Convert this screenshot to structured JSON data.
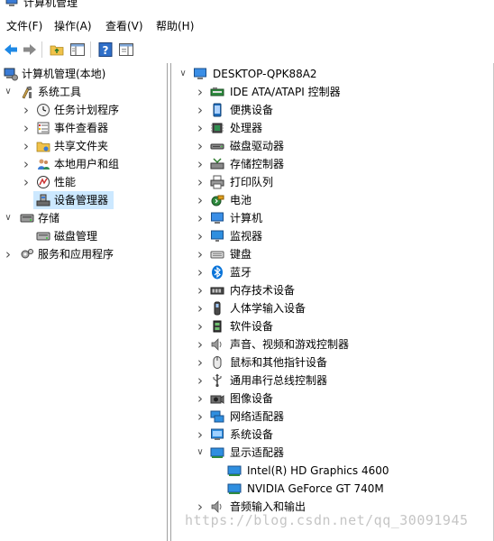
{
  "window": {
    "title": "计算机管理"
  },
  "menu": [
    "文件(F)",
    "操作(A)",
    "查看(V)",
    "帮助(H)"
  ],
  "toolbar": {
    "buttons": [
      "back-icon",
      "forward-icon",
      "up-folder-icon",
      "show-hide-tree-icon",
      "help-icon",
      "properties-icon"
    ]
  },
  "left_tree": [
    {
      "label": "计算机管理(本地)",
      "icon": "computer-management-icon",
      "level": 0,
      "expander": "none"
    },
    {
      "label": "系统工具",
      "icon": "system-tools-icon",
      "level": 1,
      "expander": "expanded"
    },
    {
      "label": "任务计划程序",
      "icon": "clock-icon",
      "level": 2,
      "expander": "collapsed"
    },
    {
      "label": "事件查看器",
      "icon": "event-viewer-icon",
      "level": 2,
      "expander": "collapsed"
    },
    {
      "label": "共享文件夹",
      "icon": "shared-folder-icon",
      "level": 2,
      "expander": "collapsed"
    },
    {
      "label": "本地用户和组",
      "icon": "users-icon",
      "level": 2,
      "expander": "collapsed"
    },
    {
      "label": "性能",
      "icon": "performance-icon",
      "level": 2,
      "expander": "collapsed"
    },
    {
      "label": "设备管理器",
      "icon": "device-manager-icon",
      "level": 2,
      "expander": "none",
      "selected": true
    },
    {
      "label": "存储",
      "icon": "storage-icon",
      "level": 1,
      "expander": "expanded"
    },
    {
      "label": "磁盘管理",
      "icon": "disk-management-icon",
      "level": 2,
      "expander": "none"
    },
    {
      "label": "服务和应用程序",
      "icon": "services-icon",
      "level": 1,
      "expander": "collapsed"
    }
  ],
  "device_tree": {
    "root": {
      "label": "DESKTOP-QPK88A2",
      "icon": "computer-icon"
    },
    "categories": [
      {
        "label": "IDE ATA/ATAPI 控制器",
        "icon": "ide-controller-icon",
        "expander": "collapsed"
      },
      {
        "label": "便携设备",
        "icon": "portable-device-icon",
        "expander": "collapsed"
      },
      {
        "label": "处理器",
        "icon": "processor-icon",
        "expander": "collapsed"
      },
      {
        "label": "磁盘驱动器",
        "icon": "disk-drive-icon",
        "expander": "collapsed"
      },
      {
        "label": "存储控制器",
        "icon": "storage-controller-icon",
        "expander": "collapsed"
      },
      {
        "label": "打印队列",
        "icon": "printer-icon",
        "expander": "collapsed"
      },
      {
        "label": "电池",
        "icon": "battery-icon",
        "expander": "collapsed"
      },
      {
        "label": "计算机",
        "icon": "computer-icon",
        "expander": "collapsed"
      },
      {
        "label": "监视器",
        "icon": "monitor-icon",
        "expander": "collapsed"
      },
      {
        "label": "键盘",
        "icon": "keyboard-icon",
        "expander": "collapsed"
      },
      {
        "label": "蓝牙",
        "icon": "bluetooth-icon",
        "expander": "collapsed"
      },
      {
        "label": "内存技术设备",
        "icon": "memory-device-icon",
        "expander": "collapsed"
      },
      {
        "label": "人体学输入设备",
        "icon": "hid-icon",
        "expander": "collapsed"
      },
      {
        "label": "软件设备",
        "icon": "software-device-icon",
        "expander": "collapsed"
      },
      {
        "label": "声音、视频和游戏控制器",
        "icon": "speaker-icon",
        "expander": "collapsed"
      },
      {
        "label": "鼠标和其他指针设备",
        "icon": "mouse-icon",
        "expander": "collapsed"
      },
      {
        "label": "通用串行总线控制器",
        "icon": "usb-icon",
        "expander": "collapsed"
      },
      {
        "label": "图像设备",
        "icon": "camera-icon",
        "expander": "collapsed"
      },
      {
        "label": "网络适配器",
        "icon": "network-adapter-icon",
        "expander": "collapsed"
      },
      {
        "label": "系统设备",
        "icon": "system-device-icon",
        "expander": "collapsed"
      },
      {
        "label": "显示适配器",
        "icon": "display-adapter-icon",
        "expander": "expanded",
        "children": [
          {
            "label": "Intel(R) HD Graphics 4600",
            "icon": "display-adapter-icon"
          },
          {
            "label": "NVIDIA GeForce GT 740M",
            "icon": "display-adapter-icon"
          }
        ]
      },
      {
        "label": "音频输入和输出",
        "icon": "speaker-icon",
        "expander": "collapsed"
      }
    ]
  },
  "watermark": "https://blog.csdn.net/qq_30091945",
  "colors": {
    "selection": "#cce8ff",
    "accent": "#0078d7"
  }
}
